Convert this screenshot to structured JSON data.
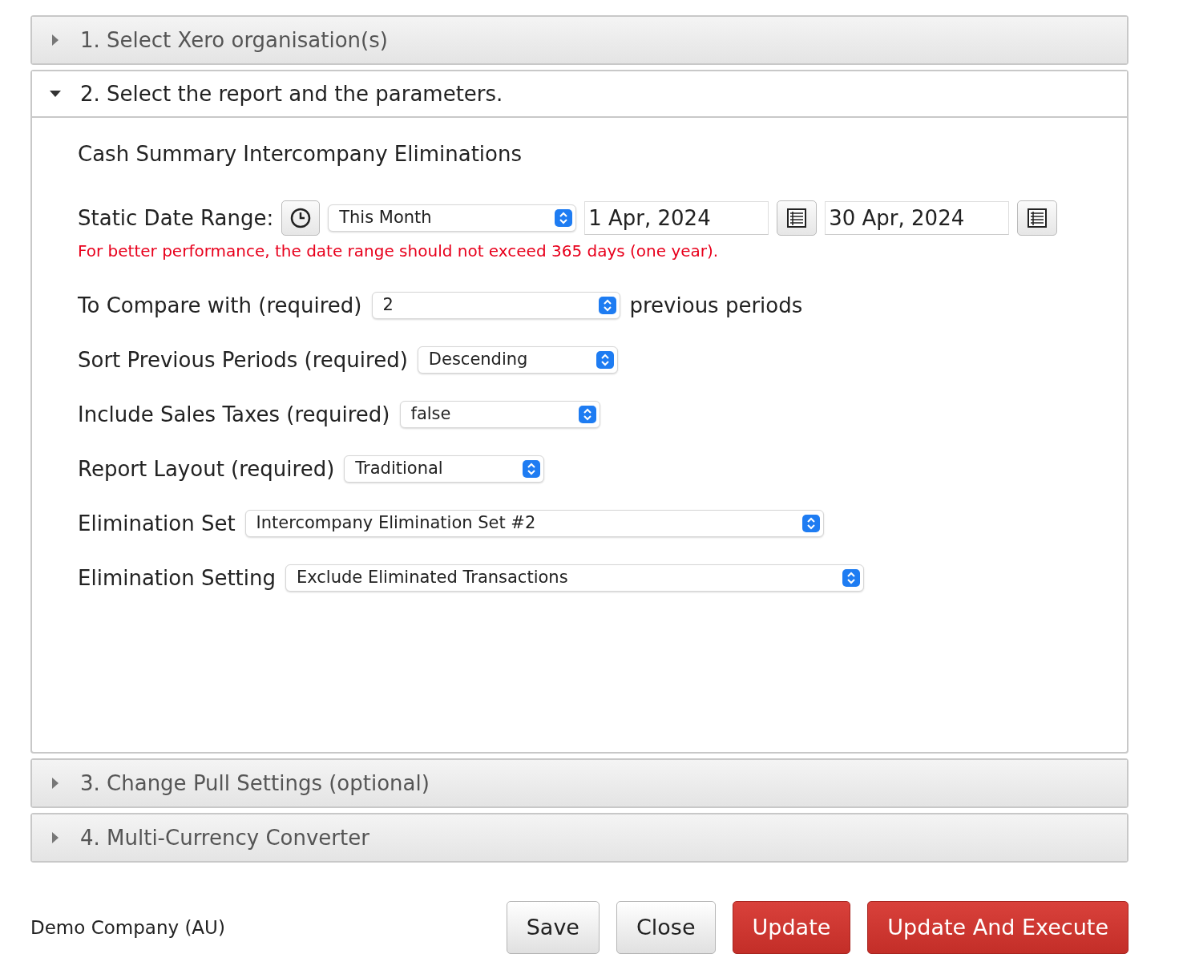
{
  "sections": [
    {
      "title": "1. Select Xero organisation(s)",
      "expanded": false
    },
    {
      "title": "2. Select the report and the parameters.",
      "expanded": true,
      "report_title": "Cash Summary Intercompany Eliminations",
      "date_range": {
        "label": "Static Date Range:",
        "preset": "This Month",
        "start": "1 Apr, 2024",
        "end": "30 Apr, 2024",
        "warning": "For better performance, the date range should not exceed 365 days (one year)."
      },
      "parameters": [
        {
          "kind": "select",
          "label": "To Compare with (required)",
          "value": "2",
          "suffix": "previous periods"
        },
        {
          "kind": "select",
          "label": "Sort Previous Periods (required)",
          "value": "Descending"
        },
        {
          "kind": "select",
          "label": "Include Sales Taxes (required)",
          "value": "false"
        },
        {
          "kind": "select",
          "label": "Report Layout (required)",
          "value": "Traditional"
        },
        {
          "kind": "wide-select",
          "label": "Elimination Set",
          "value": "Intercompany Elimination Set #2"
        },
        {
          "kind": "wide-select",
          "label": "Elimination Setting",
          "value": "Exclude Eliminated Transactions"
        }
      ]
    },
    {
      "title": "3. Change Pull Settings (optional)",
      "expanded": false
    },
    {
      "title": "4. Multi-Currency Converter",
      "expanded": false
    }
  ],
  "footer": {
    "company": "Demo Company (AU)",
    "buttons": [
      {
        "label": "Save",
        "kind": "default"
      },
      {
        "label": "Close",
        "kind": "default"
      },
      {
        "label": "Update",
        "kind": "primary"
      },
      {
        "label": "Update And Execute",
        "kind": "primary"
      }
    ]
  }
}
